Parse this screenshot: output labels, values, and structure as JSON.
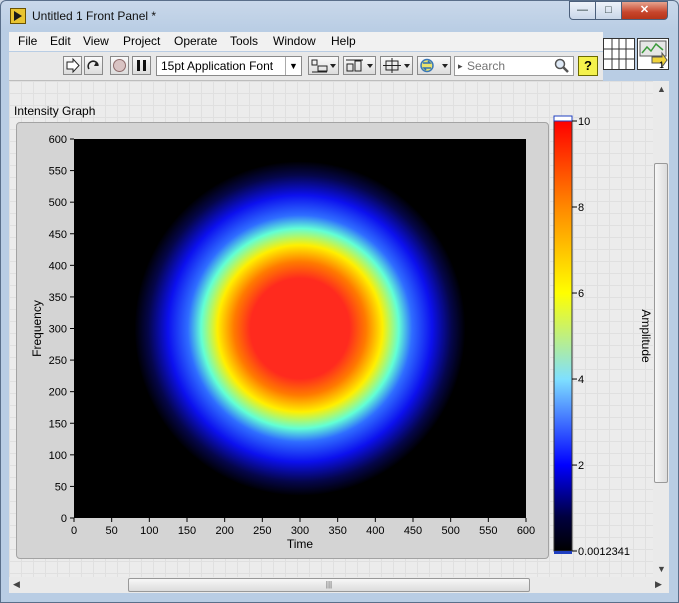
{
  "window": {
    "title": "Untitled 1 Front Panel *"
  },
  "menu": [
    "File",
    "Edit",
    "View",
    "Project",
    "Operate",
    "Tools",
    "Window",
    "Help"
  ],
  "toolbar": {
    "font_label": "15pt Application Font",
    "search_placeholder": "Search",
    "help_label": "?"
  },
  "vi_icon": {
    "number": "1"
  },
  "graph": {
    "label": "Intensity Graph"
  },
  "chart_data": {
    "type": "heatmap",
    "xlabel": "Time",
    "ylabel": "Frequency",
    "xlim": [
      0,
      600
    ],
    "ylim": [
      0,
      600
    ],
    "x_ticks": [
      0,
      50,
      100,
      150,
      200,
      250,
      300,
      350,
      400,
      450,
      500,
      550,
      600
    ],
    "y_ticks": [
      0,
      50,
      100,
      150,
      200,
      250,
      300,
      350,
      400,
      450,
      500,
      550,
      600
    ],
    "colorbar": {
      "label": "Amplitude",
      "min": 0.0012341,
      "max": 10,
      "tick_labels": [
        "10",
        "8",
        "6",
        "4",
        "2",
        "0.0012341"
      ],
      "tick_values": [
        10,
        8,
        6,
        4,
        2,
        0.0012341
      ],
      "colormap": [
        {
          "v": 0,
          "color": "#000000"
        },
        {
          "v": 2,
          "color": "#0000ff"
        },
        {
          "v": 4,
          "color": "#7fe0ff"
        },
        {
          "v": 6,
          "color": "#ffff00"
        },
        {
          "v": 8,
          "color": "#ff8800"
        },
        {
          "v": 10,
          "color": "#ff0000"
        }
      ]
    },
    "peak": {
      "x": 300,
      "y": 300,
      "value": 10
    }
  }
}
